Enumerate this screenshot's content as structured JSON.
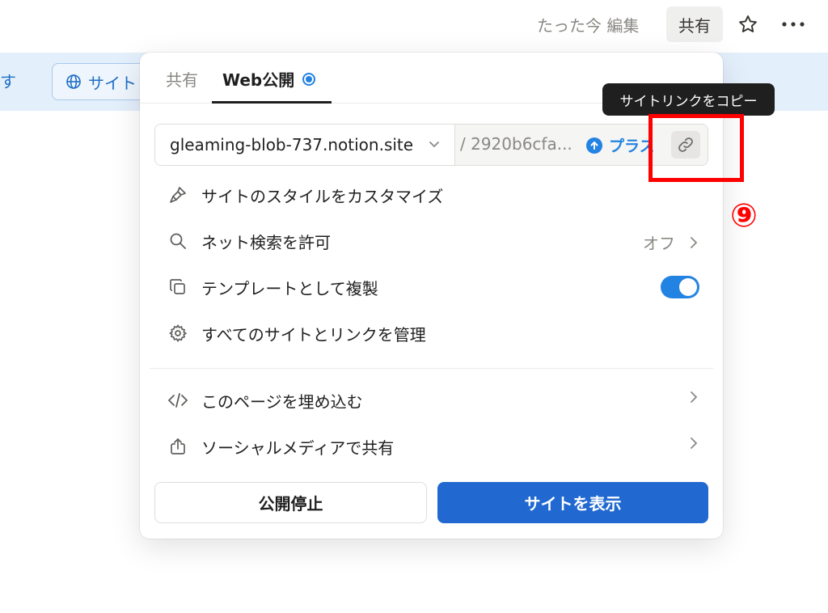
{
  "topbar": {
    "edited_status": "たった今 編集",
    "share_label": "共有"
  },
  "banner": {
    "tail_text": "す",
    "site_button_label": "サイト"
  },
  "popover": {
    "tabs": [
      {
        "label": "共有"
      },
      {
        "label": "Web公開"
      }
    ],
    "url": {
      "domain": "gleaming-blob-737.notion.site",
      "path": "/ 2920b6cfa...",
      "upgrade_label": "プラス"
    },
    "menu": [
      {
        "label": "サイトのスタイルをカスタマイズ",
        "icon": "brush-icon"
      },
      {
        "label": "ネット検索を許可",
        "value": "オフ",
        "icon": "search-icon"
      },
      {
        "label": "テンプレートとして複製",
        "icon": "duplicate-icon",
        "toggle": true
      },
      {
        "label": "すべてのサイトとリンクを管理",
        "icon": "gear-icon"
      },
      {
        "label": "このページを埋め込む",
        "icon": "code-icon"
      },
      {
        "label": "ソーシャルメディアで共有",
        "icon": "share-icon"
      }
    ],
    "unpublish_label": "公開停止",
    "view_site_label": "サイトを表示"
  },
  "tooltip": {
    "text": "サイトリンクをコピー"
  },
  "annotation": {
    "step": "⑨"
  },
  "colors": {
    "accent": "#2383e2",
    "primary_button": "#2169d0",
    "annotation": "#ff0000",
    "banner": "#e3effb"
  }
}
